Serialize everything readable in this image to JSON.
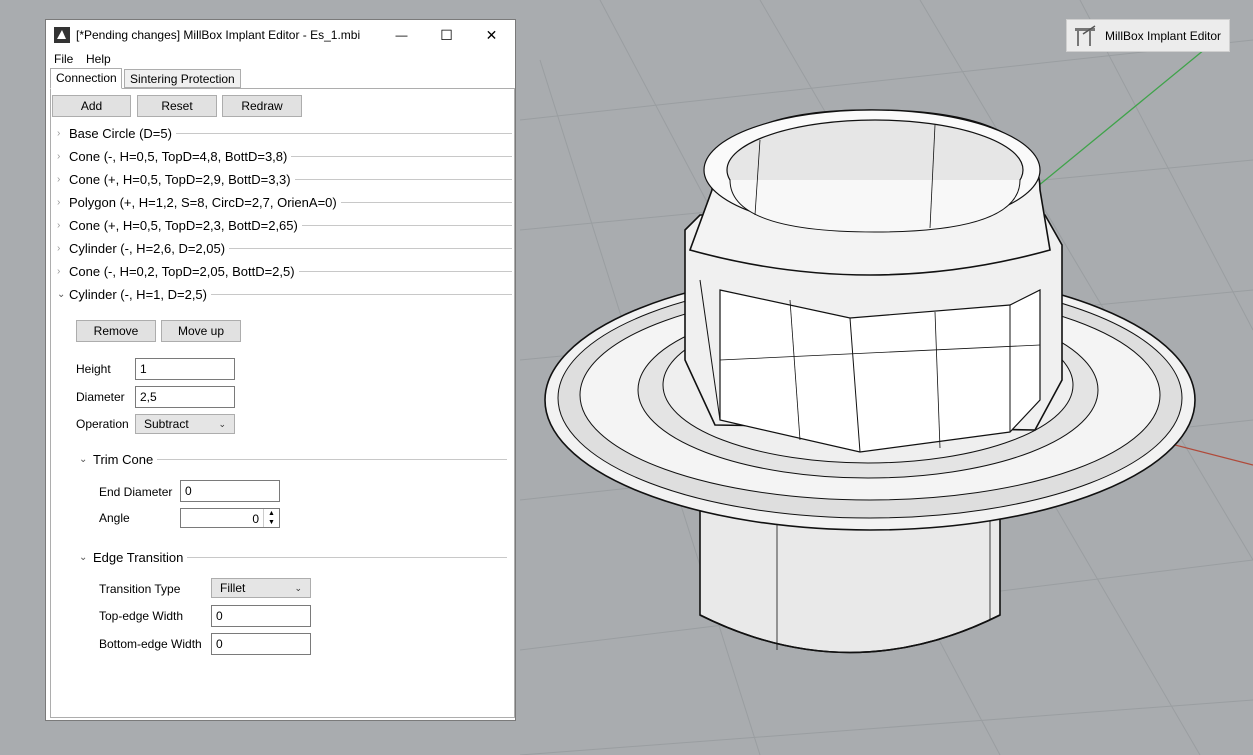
{
  "window": {
    "title": "[*Pending changes] MillBox Implant Editor -  Es_1.mbi",
    "minimize_glyph": "—",
    "maximize_glyph": "☐",
    "close_glyph": "✕"
  },
  "menu": {
    "file": "File",
    "help": "Help"
  },
  "tabs": [
    {
      "label": "Connection",
      "active": true
    },
    {
      "label": "Sintering Protection",
      "active": false
    }
  ],
  "toolbar": {
    "add": "Add",
    "reset": "Reset",
    "redraw": "Redraw"
  },
  "tree_items": [
    {
      "label": "Base Circle (D=5)",
      "expanded": false
    },
    {
      "label": "Cone (-, H=0,5, TopD=4,8, BottD=3,8)",
      "expanded": false
    },
    {
      "label": "Cone (+, H=0,5, TopD=2,9, BottD=3,3)",
      "expanded": false
    },
    {
      "label": "Polygon (+, H=1,2, S=8, CircD=2,7, OrienA=0)",
      "expanded": false
    },
    {
      "label": "Cone (+, H=0,5, TopD=2,3, BottD=2,65)",
      "expanded": false
    },
    {
      "label": "Cylinder (-, H=2,6, D=2,05)",
      "expanded": false
    },
    {
      "label": "Cone (-, H=0,2, TopD=2,05, BottD=2,5)",
      "expanded": false
    },
    {
      "label": "Cylinder (-, H=1, D=2,5)",
      "expanded": true
    }
  ],
  "chevrons": {
    "collapsed": "›",
    "expanded": "⌄",
    "dropdown": "⌄",
    "spin_up": "▲",
    "spin_down": "▼"
  },
  "detail": {
    "remove": "Remove",
    "move_up": "Move up",
    "height_label": "Height",
    "height_value": "1",
    "diameter_label": "Diameter",
    "diameter_value": "2,5",
    "operation_label": "Operation",
    "operation_value": "Subtract",
    "trim_cone": {
      "title": "Trim Cone",
      "end_diameter_label": "End Diameter",
      "end_diameter_value": "0",
      "angle_label": "Angle",
      "angle_value": "0"
    },
    "edge_transition": {
      "title": "Edge Transition",
      "type_label": "Transition Type",
      "type_value": "Fillet",
      "top_label": "Top-edge Width",
      "top_value": "0",
      "bottom_label": "Bottom-edge Width",
      "bottom_value": "0"
    }
  },
  "badge": {
    "label": "MillBox Implant Editor",
    "icon": "implant-editor-icon"
  },
  "colors": {
    "viewport_bg": "#a9acaf",
    "grid": "#9a9da0",
    "axis_x": "#b04a3a",
    "axis_y": "#3fa34a"
  }
}
